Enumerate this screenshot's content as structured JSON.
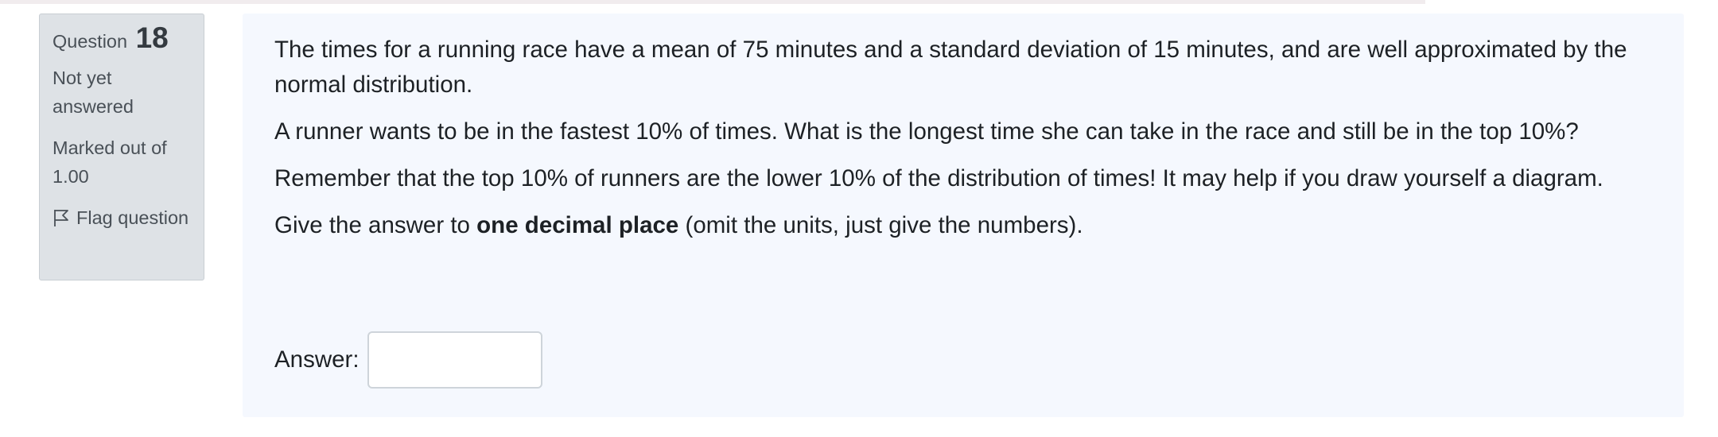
{
  "info": {
    "question_label": "Question",
    "question_number": "18",
    "state": "Not yet answered",
    "grade": "Marked out of 1.00",
    "flag_label": "Flag question"
  },
  "question": {
    "paragraph1": "The times for a running race have a mean of 75 minutes and a standard deviation of 15 minutes, and are well approximated by the normal distribution.",
    "paragraph2": "A runner wants to be in the fastest 10% of times. What is the longest time she can take in the race and still be in the top 10%?",
    "paragraph3": "Remember that the top 10% of runners are the lower 10% of the distribution of times! It may help if you draw yourself a diagram.",
    "paragraph4_before": "Give the answer to ",
    "paragraph4_bold": "one decimal place",
    "paragraph4_after": " (omit the units, just give the numbers)."
  },
  "answer": {
    "label": "Answer:",
    "value": ""
  }
}
